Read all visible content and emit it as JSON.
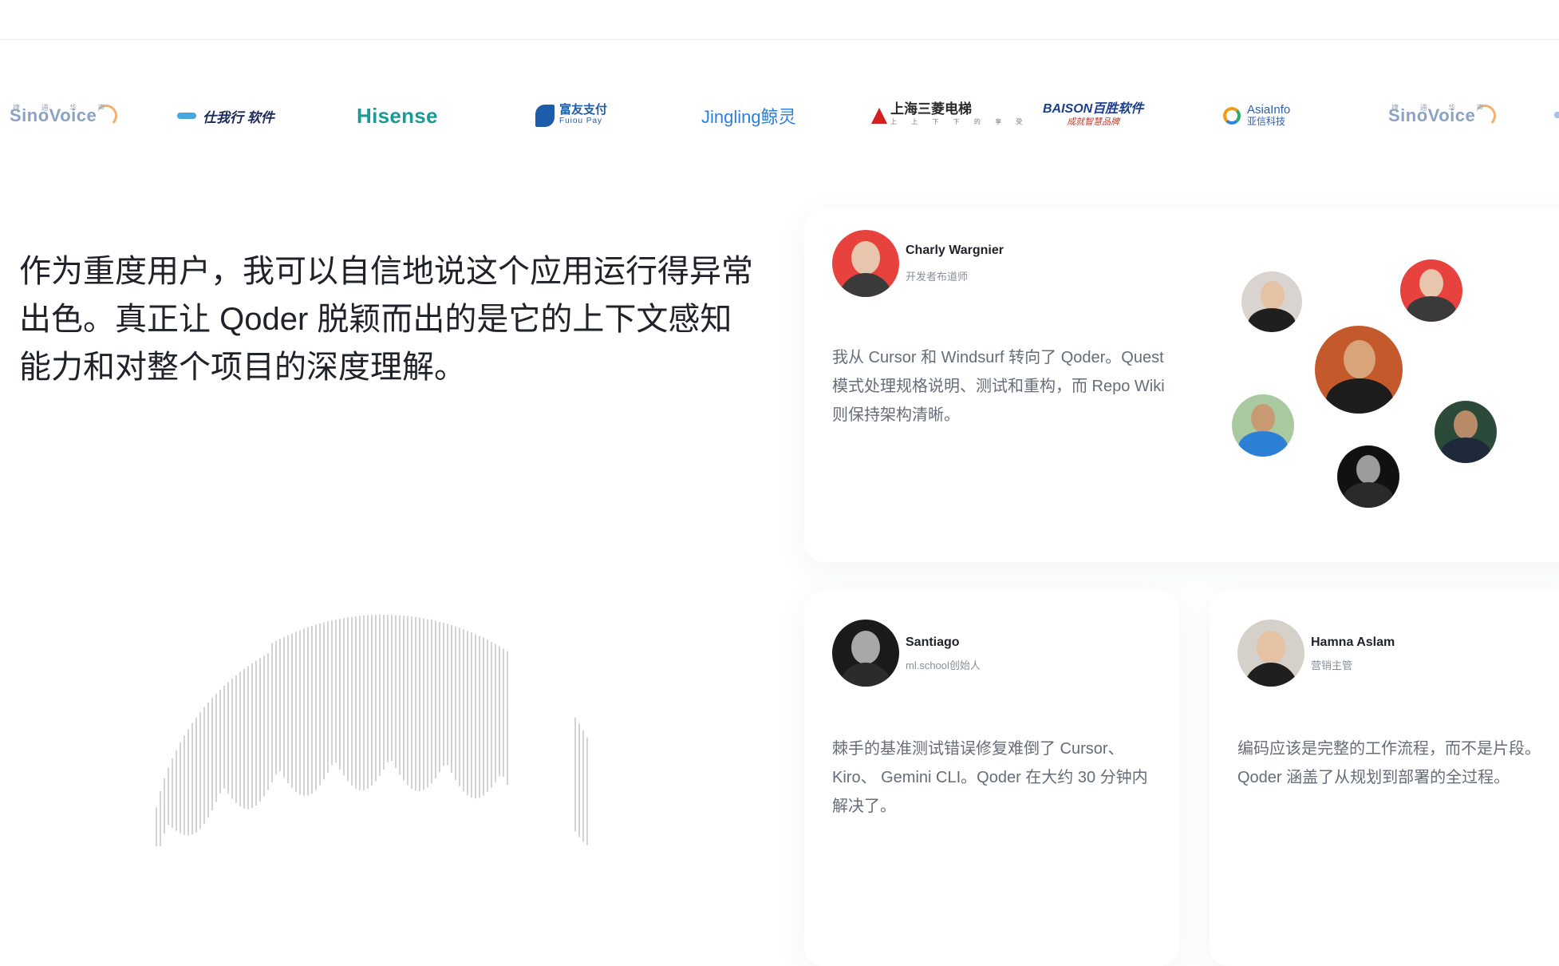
{
  "logos": [
    {
      "name": "sinovoice",
      "top": "捷 通 华 声",
      "text": "SinoVoice"
    },
    {
      "name": "shixing",
      "text": "仕我行 软件"
    },
    {
      "name": "hisense",
      "text": "Hisense"
    },
    {
      "name": "fuiou",
      "cn": "富友支付",
      "en": "Fuiou Pay"
    },
    {
      "name": "jingling",
      "text": "Jingling鲸灵"
    },
    {
      "name": "sanling",
      "cn": "上海三菱电梯",
      "sub": "上 上 下 下 的 享 受"
    },
    {
      "name": "baison",
      "en": "BAISON百胜软件",
      "cn": "成就智慧品牌"
    },
    {
      "name": "asiainfo",
      "en": "AsiaInfo",
      "cn": "亚信科技"
    },
    {
      "name": "sinovoice-2",
      "top": "捷 通 华 声",
      "text": "SinoVoice"
    }
  ],
  "hero_quote": "作为重度用户，我可以自信地说这个应用运行得异常出色。真正让 Qoder 脱颖而出的是它的上下文感知能力和对整个项目的深度理解。",
  "testimonials": [
    {
      "name": "Charly Wargnier",
      "role": "开发者布道师",
      "text": "我从 Cursor 和 Windsurf 转向了 Qoder。Quest 模式处理规格说明、测试和重构，而 Repo Wiki 则保持架构清晰。"
    },
    {
      "name": "Santiago",
      "role": "ml.school创始人",
      "text": "棘手的基准测试错误修复难倒了 Cursor、Kiro、 Gemini CLI。Qoder 在大约 30 分钟内解决了。"
    },
    {
      "name": "Hamna Aslam",
      "role": "营销主管",
      "text": "编码应该是完整的工作流程，而不是片段。Qoder 涵盖了从规划到部署的全过程。"
    }
  ],
  "colors": {
    "accent_red": "#e8423f",
    "text_primary": "#1f2329",
    "text_secondary": "#676d78"
  }
}
